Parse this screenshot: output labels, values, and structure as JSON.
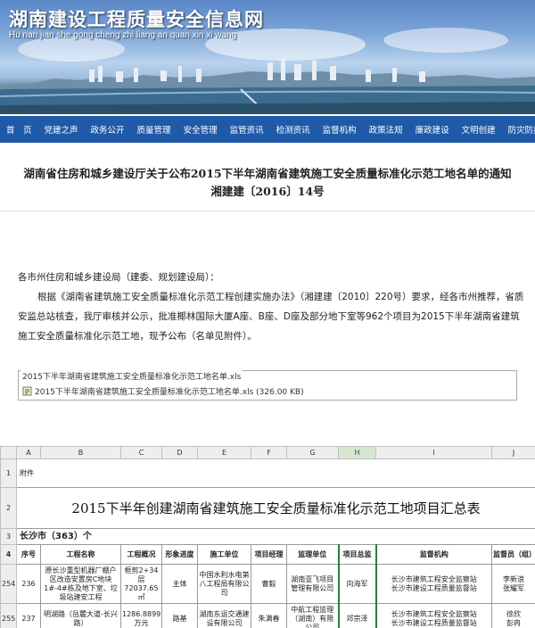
{
  "site": {
    "title": "湖南建设工程质量安全信息网",
    "subtitle": "Hu nan jian she gong cheng zhi liang an quan xin xi wang"
  },
  "nav": [
    "首　页",
    "党建之声",
    "政务公开",
    "质量管理",
    "安全管理",
    "监管资讯",
    "检测资讯",
    "监督机构",
    "政策法规",
    "廉政建设",
    "文明创建",
    "防灾防损"
  ],
  "article": {
    "title_line1": "湖南省住房和城乡建设厅关于公布2015下半年湖南省建筑施工安全质量标准化示范工地名单的通知",
    "title_line2": "湘建建〔2016〕14号",
    "salutation": "各市州住房和城乡建设局（建委、规划建设局）：",
    "paragraph": "根据《湖南省建筑施工安全质量标准化示范工程创建实施办法》（湘建建〔2010〕220号）要求，经各市州推荐，省质安监总站核查，我厅审核并公示，批准椰林国际大厦A座、B座、D座及部分地下室等962个项目为2015下半年湖南省建筑施工安全质量标准化示范工地，现予公布（名单见附件）。"
  },
  "attachment": {
    "legend": "2015下半年湖南省建筑施工安全质量标准化示范工地名单.xls",
    "file": "2015下半年湖南省建筑施工安全质量标准化示范工地名单.xls (326.00 KB)"
  },
  "sheet": {
    "columns": [
      "A",
      "B",
      "C",
      "D",
      "E",
      "F",
      "G",
      "H",
      "I",
      "J"
    ],
    "row_numbers": [
      "1",
      "2",
      "3",
      "4",
      "254",
      "255"
    ],
    "r1_label": "附件",
    "r2_title": "2015下半年创建湖南省建筑施工安全质量标准化示范工地项目汇总表",
    "r3_city": "长沙市（363）个",
    "headers": [
      "序号",
      "工程名称",
      "工程概况",
      "形象进度",
      "施工单位",
      "项目经理",
      "监理单位",
      "项目总监",
      "监督机构",
      "监督员（组）"
    ],
    "rows": [
      [
        "236",
        "原长沙重型机器厂棚户区改造安置房C地块1#-4#栋及地下室、垃圾站建安工程",
        "框剪2+34层 72037.65㎡",
        "主体",
        "中国水利水电第八工程局有限公司",
        "曹毅",
        "湖南亚飞项目管理有限公司",
        "向海军",
        "长沙市建筑工程安全监察站\n长沙市建设工程质量监督站",
        "李新浪\n张耀军"
      ],
      [
        "237",
        "明湖路（岳麓大道-长兴路）",
        "1286.8899万元",
        "路基",
        "湖南东运交通建设有限公司",
        "朱满春",
        "中航工程监理（湖南）有限公司",
        "邓宗泽",
        "长沙市建筑工程安全监察站\n长沙市建设工程质量监督站",
        "徐欣\n彭冉"
      ]
    ]
  },
  "colors": {
    "nav_bg": "#1f5aa8",
    "selection_green": "#2e7d32"
  }
}
